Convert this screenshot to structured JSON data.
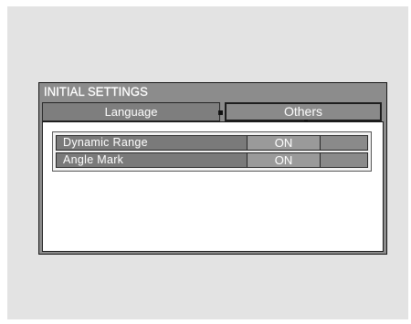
{
  "window": {
    "title": "INITIAL SETTINGS"
  },
  "tabs": [
    {
      "label": "Language",
      "selected": false
    },
    {
      "label": "Others",
      "selected": true
    }
  ],
  "settings": [
    {
      "label": "Dynamic Range",
      "value": "ON"
    },
    {
      "label": "Angle Mark",
      "value": "ON"
    }
  ],
  "colors": {
    "backdrop": "#e3e3e3",
    "window_frame": "#8c8c8c",
    "row_fill": "#7a7a7a",
    "value_fill": "#9a9a9a",
    "panel": "#ffffff",
    "text": "#ffffff"
  }
}
